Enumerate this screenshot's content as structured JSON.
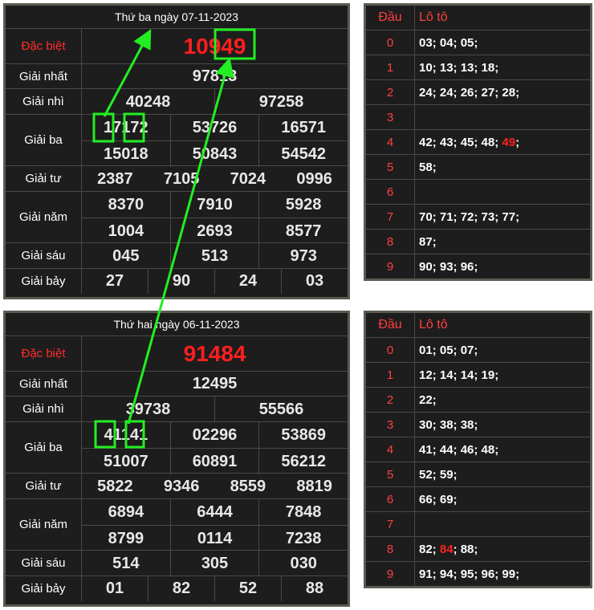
{
  "draws": [
    {
      "title": "Thứ ba ngày 07-11-2023",
      "labels": {
        "db": "Đặc biệt",
        "g1": "Giải nhất",
        "g2": "Giải nhì",
        "g3": "Giải ba",
        "g4": "Giải tư",
        "g5": "Giải năm",
        "g6": "Giải sáu",
        "g7": "Giải bảy"
      },
      "db": "10949",
      "g1": "97813",
      "g2": [
        "40248",
        "97258"
      ],
      "g3": [
        "17172",
        "53726",
        "16571",
        "15018",
        "50843",
        "54542"
      ],
      "g4": [
        "2387",
        "7105",
        "7024",
        "0996"
      ],
      "g5": [
        "8370",
        "7910",
        "5928",
        "1004",
        "2693",
        "8577"
      ],
      "g6": [
        "045",
        "513",
        "973"
      ],
      "g7": [
        "27",
        "90",
        "24",
        "03"
      ],
      "loto_header": {
        "dau": "Đầu",
        "loto": "Lô tô"
      },
      "loto": [
        {
          "d": "0",
          "v": "03; 04; 05;",
          "hl": ""
        },
        {
          "d": "1",
          "v": "10; 13; 13; 18;",
          "hl": ""
        },
        {
          "d": "2",
          "v": "24; 24; 26; 27; 28;",
          "hl": ""
        },
        {
          "d": "3",
          "v": "",
          "hl": ""
        },
        {
          "d": "4",
          "v": "42; 43; 45; 48; ",
          "hl": "49",
          "tail": ";"
        },
        {
          "d": "5",
          "v": "58;",
          "hl": ""
        },
        {
          "d": "6",
          "v": "",
          "hl": ""
        },
        {
          "d": "7",
          "v": "70; 71; 72; 73; 77;",
          "hl": ""
        },
        {
          "d": "8",
          "v": "87;",
          "hl": ""
        },
        {
          "d": "9",
          "v": "90; 93; 96;",
          "hl": ""
        }
      ]
    },
    {
      "title": "Thứ hai ngày 06-11-2023",
      "labels": {
        "db": "Đặc biệt",
        "g1": "Giải nhất",
        "g2": "Giải nhì",
        "g3": "Giải ba",
        "g4": "Giải tư",
        "g5": "Giải năm",
        "g6": "Giải sáu",
        "g7": "Giải bảy"
      },
      "db": "91484",
      "g1": "12495",
      "g2": [
        "39738",
        "55566"
      ],
      "g3": [
        "41141",
        "02296",
        "53869",
        "51007",
        "60891",
        "56212"
      ],
      "g4": [
        "5822",
        "9346",
        "8559",
        "8819"
      ],
      "g5": [
        "6894",
        "6444",
        "7848",
        "8799",
        "0114",
        "7238"
      ],
      "g6": [
        "514",
        "305",
        "030"
      ],
      "g7": [
        "01",
        "82",
        "52",
        "88"
      ],
      "loto_header": {
        "dau": "Đầu",
        "loto": "Lô tô"
      },
      "loto": [
        {
          "d": "0",
          "v": "01; 05; 07;",
          "hl": ""
        },
        {
          "d": "1",
          "v": "12; 14; 14; 19;",
          "hl": ""
        },
        {
          "d": "2",
          "v": "22;",
          "hl": ""
        },
        {
          "d": "3",
          "v": "30; 38; 38;",
          "hl": ""
        },
        {
          "d": "4",
          "v": "41; 44; 46; 48;",
          "hl": ""
        },
        {
          "d": "5",
          "v": "52; 59;",
          "hl": ""
        },
        {
          "d": "6",
          "v": "66; 69;",
          "hl": ""
        },
        {
          "d": "7",
          "v": "",
          "hl": ""
        },
        {
          "d": "8",
          "v": "82; ",
          "hl": "84",
          "tail": "; 88;"
        },
        {
          "d": "9",
          "v": "91; 94; 95; 96; 99;",
          "hl": ""
        }
      ]
    }
  ],
  "colors": {
    "highlight_box": "#22ee22",
    "arrow": "#22ee22",
    "special": "#ff1e1e"
  }
}
